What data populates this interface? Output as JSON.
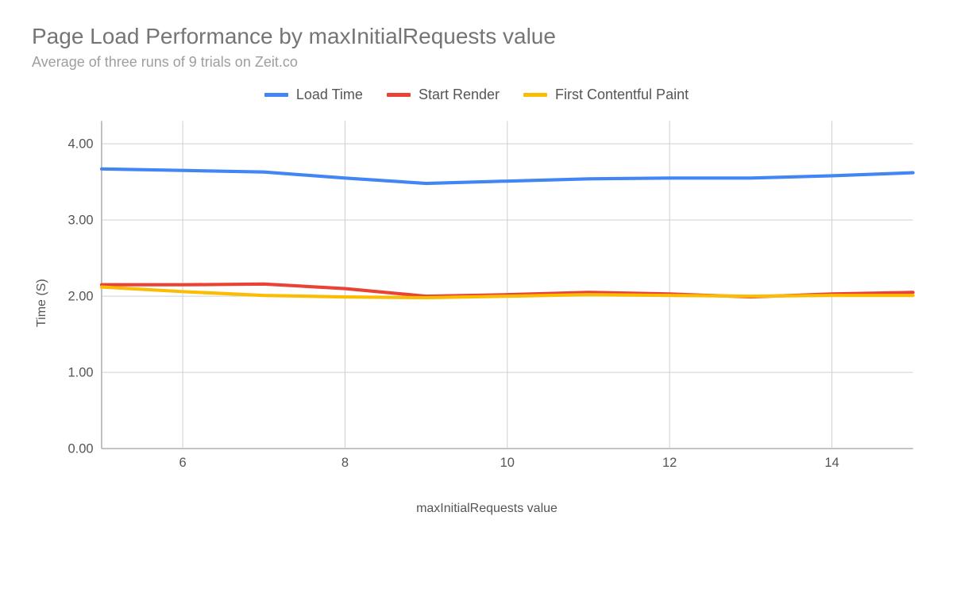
{
  "chart_data": {
    "type": "line",
    "title": "Page Load Performance by maxInitialRequests value",
    "subtitle": "Average of three runs of 9 trials on Zeit.co",
    "xlabel": "maxInitialRequests value",
    "ylabel": "Time (S)",
    "x": [
      5,
      6,
      7,
      8,
      9,
      10,
      11,
      12,
      13,
      14,
      15
    ],
    "x_ticks": [
      6,
      8,
      10,
      12,
      14
    ],
    "y_ticks": [
      0.0,
      1.0,
      2.0,
      3.0,
      4.0
    ],
    "ylim": [
      0,
      4.3
    ],
    "xlim": [
      5,
      15
    ],
    "series": [
      {
        "name": "Load Time",
        "color": "#4285f4",
        "values": [
          3.67,
          3.65,
          3.63,
          3.55,
          3.48,
          3.51,
          3.54,
          3.55,
          3.55,
          3.58,
          3.62
        ]
      },
      {
        "name": "Start Render",
        "color": "#ea4335",
        "values": [
          2.15,
          2.15,
          2.16,
          2.1,
          2.0,
          2.02,
          2.05,
          2.03,
          1.99,
          2.03,
          2.05
        ]
      },
      {
        "name": "First Contentful Paint",
        "color": "#fbbc04",
        "values": [
          2.12,
          2.06,
          2.01,
          1.99,
          1.98,
          2.0,
          2.02,
          2.01,
          2.0,
          2.01,
          2.01
        ]
      }
    ]
  }
}
